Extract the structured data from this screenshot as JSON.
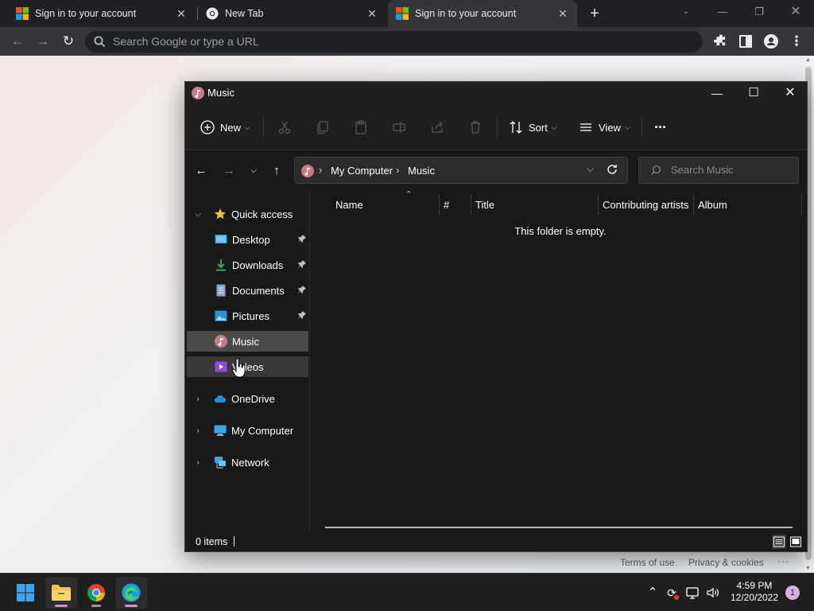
{
  "browser": {
    "tabs": [
      {
        "title": "Sign in to your account",
        "favicon": "microsoft-logo"
      },
      {
        "title": "New Tab",
        "favicon": "chrome-logo"
      },
      {
        "title": "Sign in to your account",
        "favicon": "microsoft-logo"
      }
    ],
    "new_tab": "+",
    "omnibox_placeholder": "Search Google or type a URL"
  },
  "page": {
    "footer": {
      "terms": "Terms of use",
      "privacy": "Privacy & cookies",
      "more": "..."
    }
  },
  "explorer": {
    "title": "Music",
    "commands": {
      "new": "New",
      "sort": "Sort",
      "view": "View",
      "more": "···"
    },
    "breadcrumb": [
      "My Computer",
      "Music"
    ],
    "search_placeholder": "Search Music",
    "nav": {
      "quick_access": "Quick access",
      "desktop": "Desktop",
      "downloads": "Downloads",
      "documents": "Documents",
      "pictures": "Pictures",
      "music": "Music",
      "videos": "Videos",
      "onedrive": "OneDrive",
      "my_computer": "My Computer",
      "network": "Network"
    },
    "columns": [
      "Name",
      "#",
      "Title",
      "Contributing artists",
      "Album"
    ],
    "empty_message": "This folder is empty.",
    "status": "0 items"
  },
  "taskbar": {
    "time": "4:59 PM",
    "date": "12/20/2022",
    "notification_count": "1"
  },
  "colors": {
    "explorer_bg": "#191919",
    "selection": "#4a4a4a",
    "accent_pink": "#dd8fbf"
  }
}
